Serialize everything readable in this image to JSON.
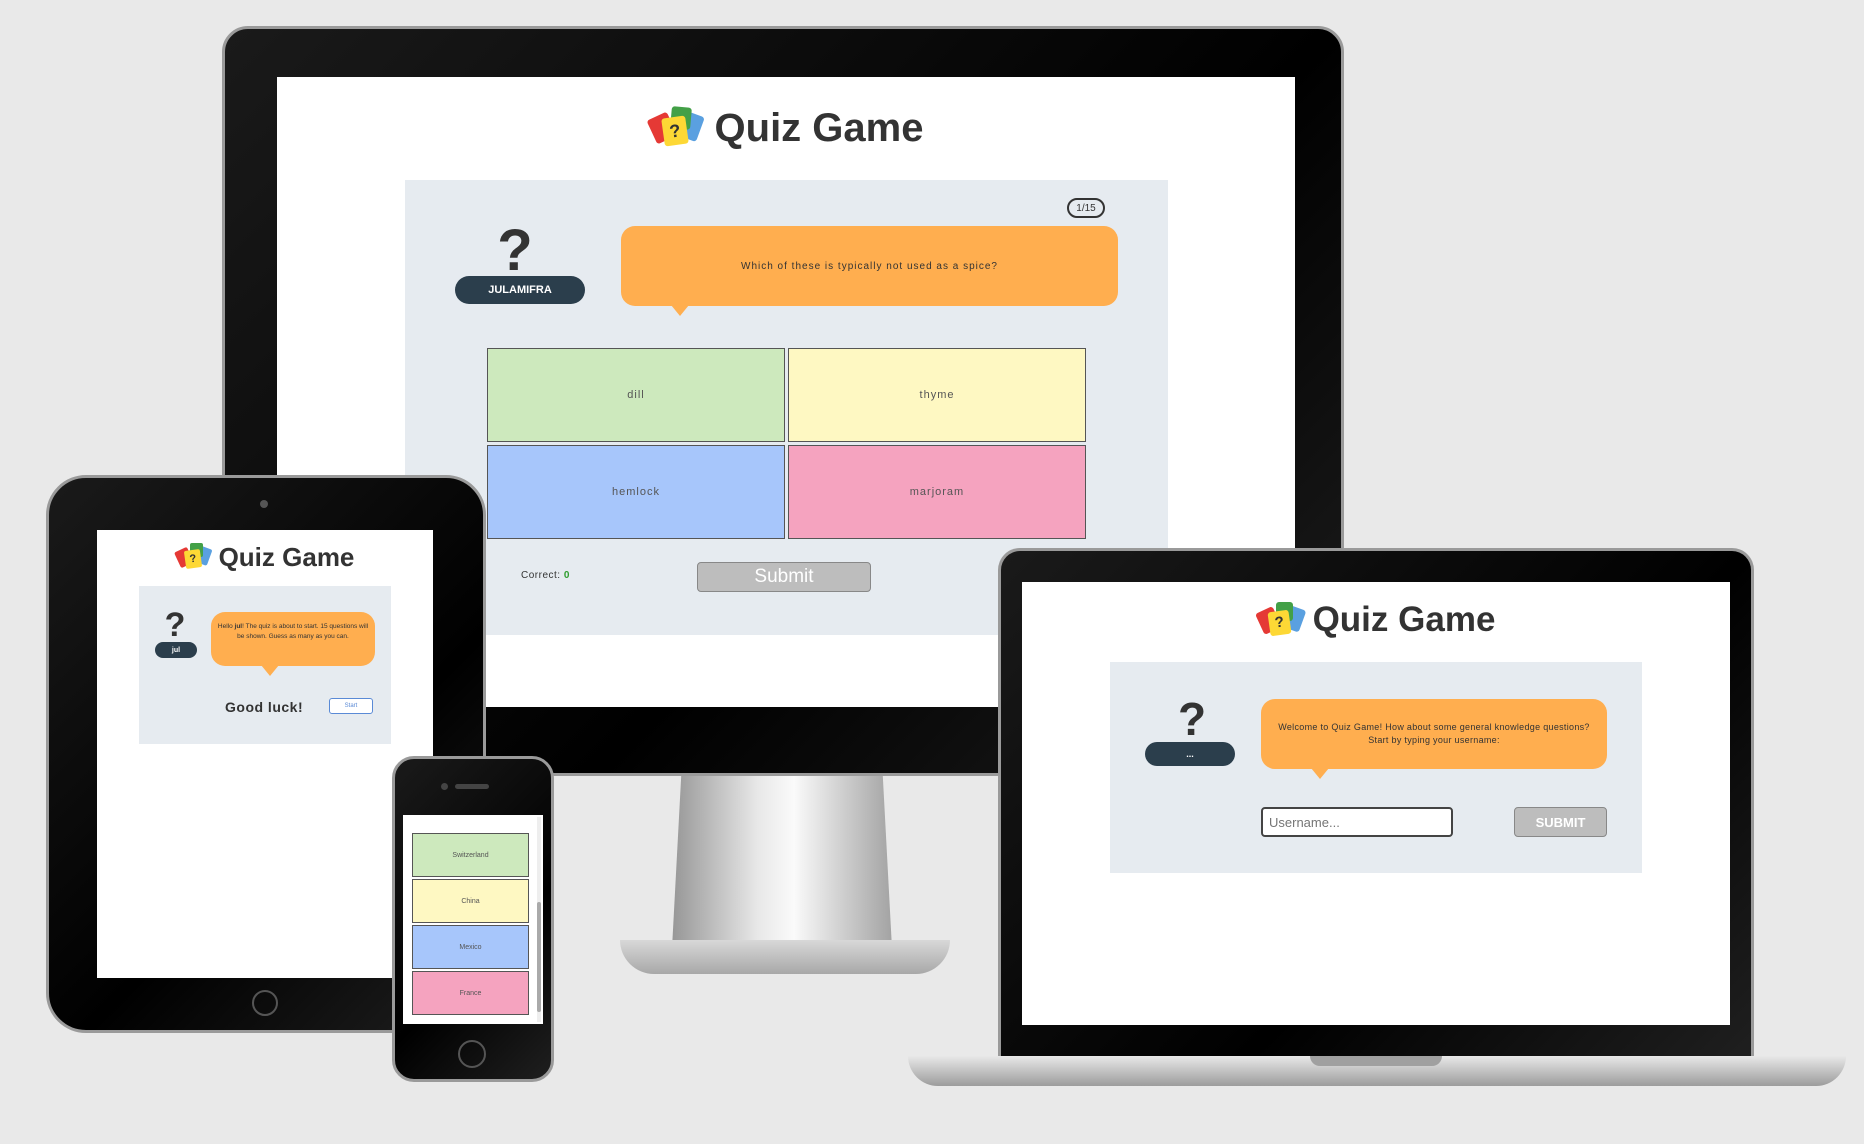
{
  "app_title": "Quiz Game",
  "desktop": {
    "counter": "1/15",
    "username": "JULAMIFRA",
    "question": "Which of these is typically not used as a spice?",
    "answers": [
      "dill",
      "thyme",
      "hemlock",
      "marjoram"
    ],
    "correct_label": "Correct:",
    "correct_value": "0",
    "submit_label": "Submit"
  },
  "tablet": {
    "username": "jul",
    "greeting_pre": "Hello ",
    "greeting_name": "jul",
    "greeting_post": "! The quiz is about to start. 15 questions will be shown. Guess as many as you can.",
    "good_luck": "Good luck!",
    "start_label": "Start"
  },
  "phone": {
    "answers": [
      "Switzerland",
      "China",
      "Mexico",
      "France"
    ]
  },
  "laptop": {
    "username": "...",
    "welcome": "Welcome to Quiz Game! How about some general knowledge questions? Start by typing your username:",
    "input_placeholder": "Username...",
    "submit_label": "SUBMIT"
  },
  "colors": {
    "bubble": "#ffae4f",
    "card": "#e6ebf0",
    "pill": "#2b3e4c"
  }
}
